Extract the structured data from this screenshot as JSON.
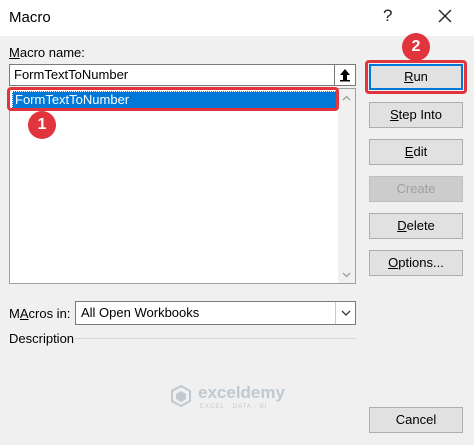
{
  "window": {
    "title": "Macro",
    "help": "?"
  },
  "macro_name": {
    "label_key": "M",
    "label_rest": "acro name:",
    "value": "FormTextToNumber"
  },
  "macro_list": {
    "items": [
      "FormTextToNumber"
    ],
    "selected_index": 0
  },
  "buttons": {
    "run": {
      "key": "R",
      "rest": "un"
    },
    "step_into": {
      "key": "S",
      "rest": "tep Into"
    },
    "edit": {
      "key": "E",
      "rest": "dit"
    },
    "create": {
      "label": "Create"
    },
    "delete": {
      "key": "D",
      "rest": "elete"
    },
    "options": {
      "key": "O",
      "rest": "ptions..."
    },
    "cancel": {
      "label": "Cancel"
    }
  },
  "macros_in": {
    "label_key": "A",
    "label_pre": "M",
    "label_rest": "cros in:",
    "value": "All Open Workbooks"
  },
  "description": {
    "label": "Description"
  },
  "annotations": {
    "badge1": "1",
    "badge2": "2",
    "accent": "#e0353c"
  },
  "watermark": {
    "name": "exceldemy",
    "tagline": "EXCEL · DATA · BI"
  },
  "colors": {
    "selection": "#0078d7",
    "dialog_bg": "#f0f0f0",
    "button_bg": "#e1e1e1"
  }
}
